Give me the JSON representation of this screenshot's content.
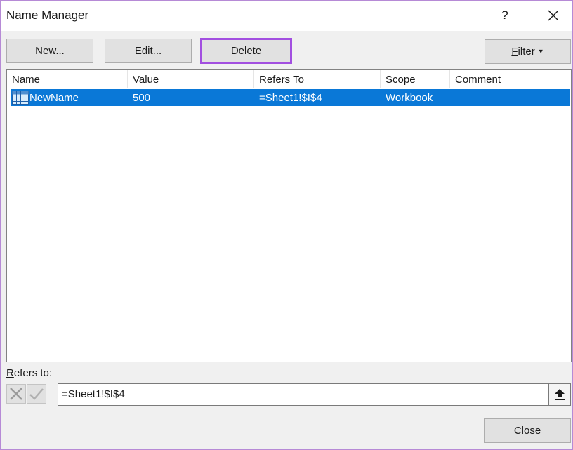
{
  "window": {
    "title": "Name Manager",
    "help_label": "?"
  },
  "toolbar": {
    "new_label": "N",
    "new_rest": "ew...",
    "edit_label": "E",
    "edit_rest": "dit...",
    "delete_label": "D",
    "delete_rest": "elete",
    "filter_label": "F",
    "filter_rest": "ilter"
  },
  "table": {
    "columns": [
      "Name",
      "Value",
      "Refers To",
      "Scope",
      "Comment"
    ],
    "rows": [
      {
        "icon": "named-range-grid-icon",
        "name": "NewName",
        "value": "500",
        "refers_to": "=Sheet1!$I$4",
        "scope": "Workbook",
        "comment": "",
        "selected": true
      }
    ]
  },
  "refers_to": {
    "label_mnemonic": "R",
    "label_rest": "efers to:",
    "value": "=Sheet1!$I$4"
  },
  "footer": {
    "close_label": "Close"
  },
  "colors": {
    "selection": "#0a78d7",
    "highlight_border": "#a24fe0",
    "dialog_border": "#b68ad6"
  }
}
